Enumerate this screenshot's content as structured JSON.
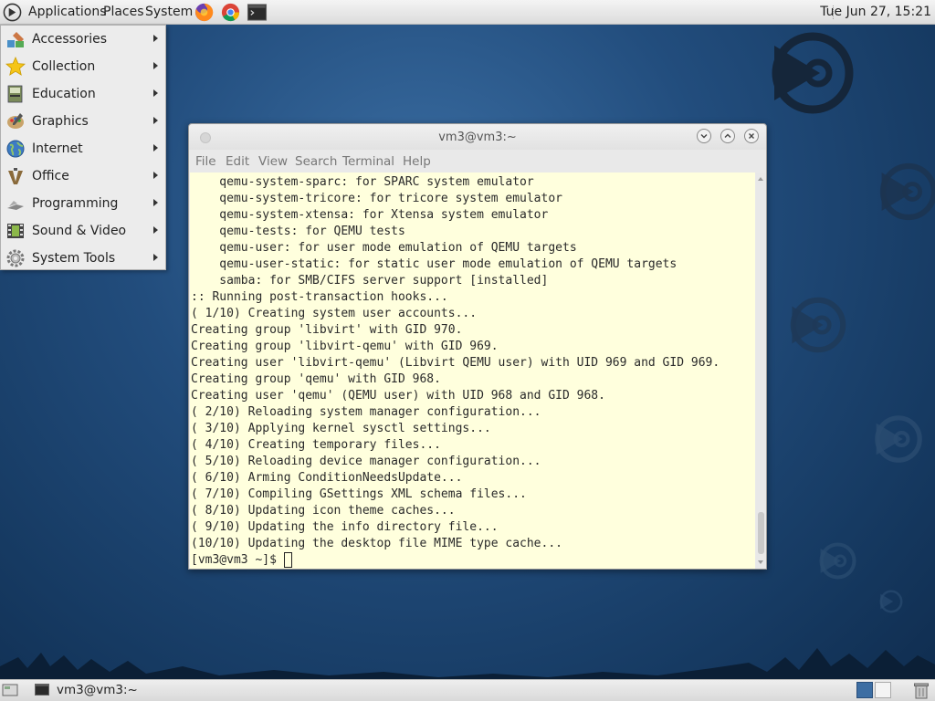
{
  "top_panel": {
    "menus": {
      "applications": "Applications",
      "places": "Places",
      "system": "System"
    },
    "launchers": [
      "firefox-icon",
      "chrome-icon",
      "terminal-icon"
    ],
    "clock": "Tue Jun 27, 15:21"
  },
  "apps_menu": {
    "items": [
      {
        "label": "Accessories",
        "icon": "accessories-icon"
      },
      {
        "label": "Collection",
        "icon": "star-icon"
      },
      {
        "label": "Education",
        "icon": "education-icon"
      },
      {
        "label": "Graphics",
        "icon": "graphics-icon"
      },
      {
        "label": "Internet",
        "icon": "globe-icon"
      },
      {
        "label": "Office",
        "icon": "office-icon"
      },
      {
        "label": "Programming",
        "icon": "programming-icon"
      },
      {
        "label": "Sound & Video",
        "icon": "sound-video-icon"
      },
      {
        "label": "System Tools",
        "icon": "gear-icon"
      }
    ]
  },
  "terminal": {
    "title": "vm3@vm3:~",
    "menu": [
      "File",
      "Edit",
      "View",
      "Search",
      "Terminal",
      "Help"
    ],
    "lines": [
      "    qemu-system-sparc: for SPARC system emulator",
      "    qemu-system-tricore: for tricore system emulator",
      "    qemu-system-xtensa: for Xtensa system emulator",
      "    qemu-tests: for QEMU tests",
      "    qemu-user: for user mode emulation of QEMU targets",
      "    qemu-user-static: for static user mode emulation of QEMU targets",
      "    samba: for SMB/CIFS server support [installed]",
      ":: Running post-transaction hooks...",
      "( 1/10) Creating system user accounts...",
      "Creating group 'libvirt' with GID 970.",
      "Creating group 'libvirt-qemu' with GID 969.",
      "Creating user 'libvirt-qemu' (Libvirt QEMU user) with UID 969 and GID 969.",
      "Creating group 'qemu' with GID 968.",
      "Creating user 'qemu' (QEMU user) with UID 968 and GID 968.",
      "( 2/10) Reloading system manager configuration...",
      "( 3/10) Applying kernel sysctl settings...",
      "( 4/10) Creating temporary files...",
      "( 5/10) Reloading device manager configuration...",
      "( 6/10) Arming ConditionNeedsUpdate...",
      "( 7/10) Compiling GSettings XML schema files...",
      "( 8/10) Updating icon theme caches...",
      "( 9/10) Updating the info directory file...",
      "(10/10) Updating the desktop file MIME type cache...",
      "[vm3@vm3 ~]$ "
    ]
  },
  "bottom_panel": {
    "task_label": "vm3@vm3:~",
    "workspaces": 2
  },
  "colors": {
    "terminal_bg": "#ffffdd",
    "desktop_bg": "#224d7d",
    "workspace_active": "#3d6ea3"
  }
}
